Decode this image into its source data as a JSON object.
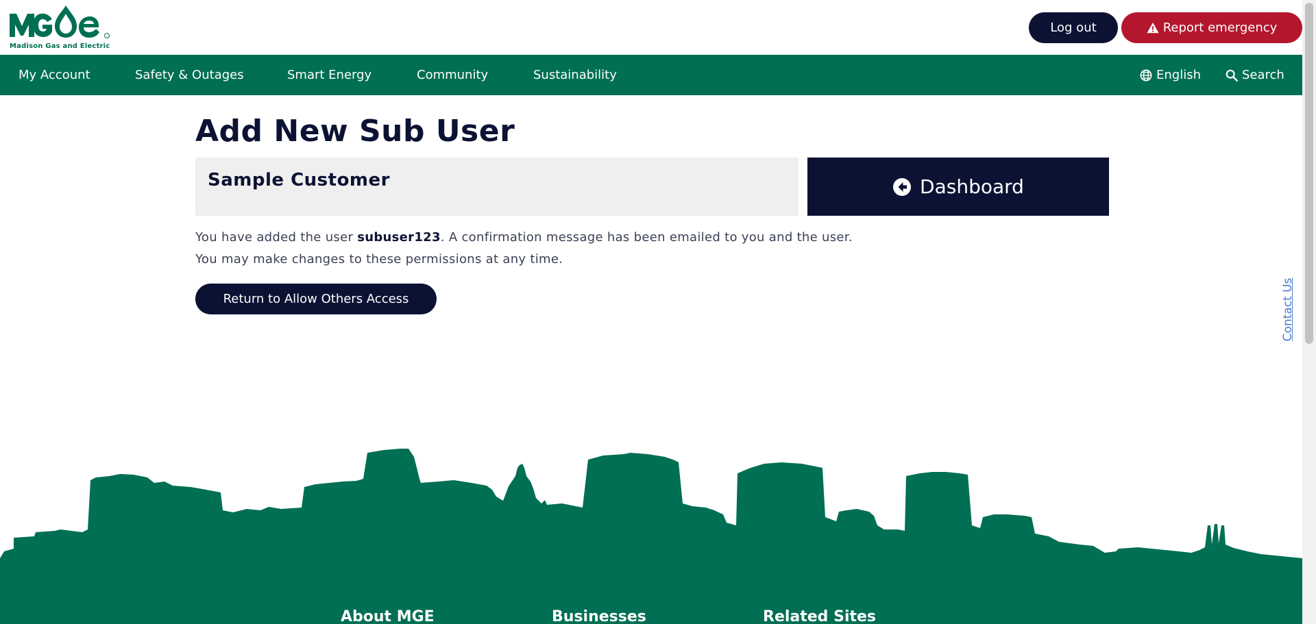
{
  "brand": {
    "logo_text": "MGE",
    "logo_tagline": "Madison Gas and Electric",
    "green": "#006f53",
    "navy": "#0c1233",
    "red": "#b3162d"
  },
  "header": {
    "logout_label": "Log out",
    "emergency_label": "Report emergency",
    "emergency_icon": "warning-icon"
  },
  "nav": {
    "items": [
      "My Account",
      "Safety & Outages",
      "Smart Energy",
      "Community",
      "Sustainability"
    ],
    "language_label": "English",
    "language_icon": "globe-icon",
    "search_label": "Search",
    "search_icon": "search-icon"
  },
  "main": {
    "title": "Add New Sub User",
    "customer_name": "Sample Customer",
    "dashboard_label": "Dashboard",
    "dashboard_icon": "arrow-left-circle-icon",
    "message_prefix": "You have added the user ",
    "message_user": "subuser123",
    "message_suffix": ". A confirmation message has been emailed to you and the user.",
    "message_line2": "You may make changes to these permissions at any time.",
    "return_label": "Return to Allow Others Access"
  },
  "side": {
    "contact_label": "Contact Us"
  },
  "footer": {
    "headings": [
      "About MGE",
      "Businesses",
      "Related Sites"
    ]
  }
}
